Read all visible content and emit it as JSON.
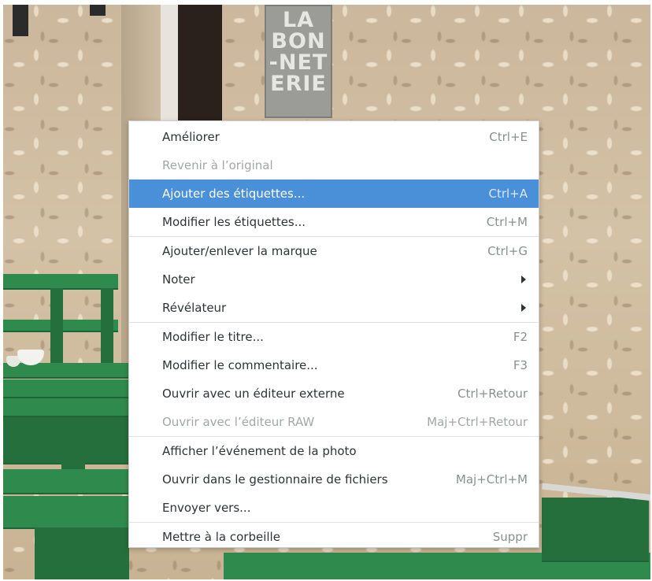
{
  "background": {
    "sign_lines": [
      "LA",
      "BON",
      "-NET",
      "ERIE"
    ]
  },
  "colors": {
    "highlight": "#4a90d9",
    "menu_text": "#2e3436",
    "accelerator_text": "#8a8f8f",
    "disabled_text": "#a3a6a6"
  },
  "menu": {
    "groups": [
      [
        {
          "label": "Améliorer",
          "accel": "Ctrl+E",
          "enabled": true
        },
        {
          "label": "Revenir à l’original",
          "accel": "",
          "enabled": false
        },
        {
          "label": "Ajouter des étiquettes...",
          "accel": "Ctrl+A",
          "enabled": true,
          "highlighted": true
        },
        {
          "label": "Modifier les étiquettes...",
          "accel": "Ctrl+M",
          "enabled": true
        }
      ],
      [
        {
          "label": "Ajouter/enlever la marque",
          "accel": "Ctrl+G",
          "enabled": true
        },
        {
          "label": "Noter",
          "accel": "",
          "enabled": true,
          "submenu": true,
          "icon": "chevron-right-icon"
        },
        {
          "label": "Révélateur",
          "accel": "",
          "enabled": true,
          "submenu": true,
          "icon": "chevron-right-icon"
        }
      ],
      [
        {
          "label": "Modifier le titre...",
          "accel": "F2",
          "enabled": true
        },
        {
          "label": "Modifier le commentaire...",
          "accel": "F3",
          "enabled": true
        },
        {
          "label": "Ouvrir avec un éditeur externe",
          "accel": "Ctrl+Retour",
          "enabled": true
        },
        {
          "label": "Ouvrir avec l’éditeur RAW",
          "accel": "Maj+Ctrl+Retour",
          "enabled": false
        }
      ],
      [
        {
          "label": "Afficher l’événement de la photo",
          "accel": "",
          "enabled": true
        },
        {
          "label": "Ouvrir dans le gestionnaire de fichiers",
          "accel": "Maj+Ctrl+M",
          "enabled": true
        },
        {
          "label": "Envoyer vers...",
          "accel": "",
          "enabled": true
        }
      ],
      [
        {
          "label": "Mettre à la corbeille",
          "accel": "Suppr",
          "enabled": true
        }
      ]
    ]
  }
}
